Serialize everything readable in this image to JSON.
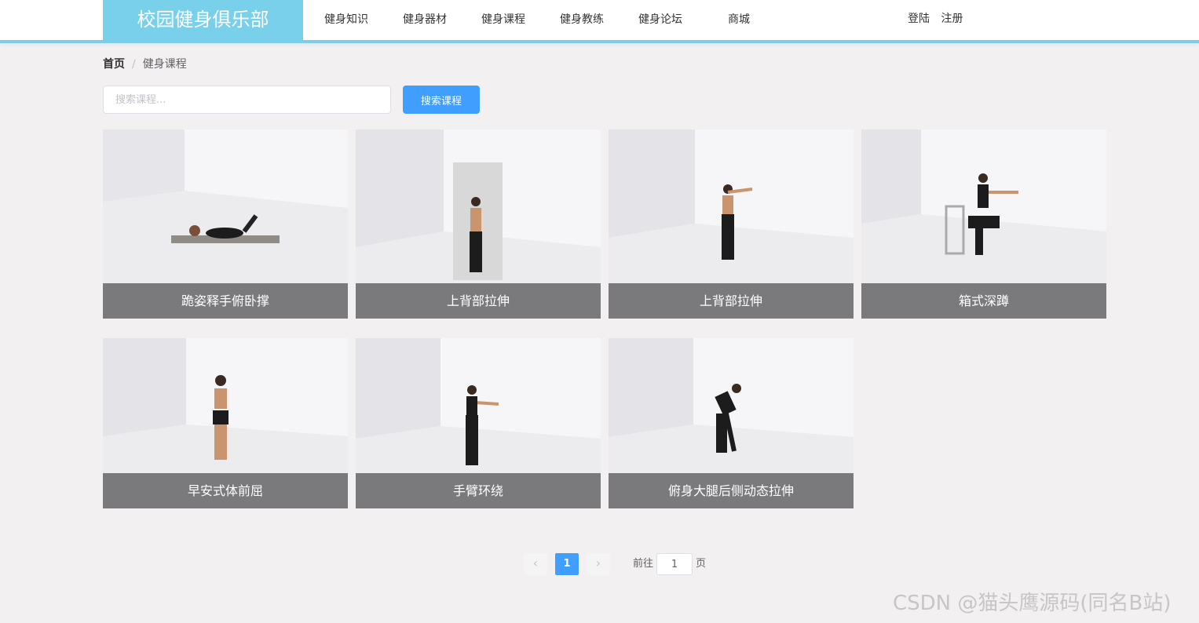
{
  "header": {
    "logo": "校园健身俱乐部",
    "nav": [
      "健身知识",
      "健身器材",
      "健身课程",
      "健身教练",
      "健身论坛",
      "商城"
    ],
    "login": "登陆",
    "register": "注册"
  },
  "breadcrumb": {
    "home": "首页",
    "separator": "/",
    "current": "健身课程"
  },
  "search": {
    "placeholder": "搜索课程...",
    "button": "搜索课程"
  },
  "courses": [
    {
      "title": "跪姿释手俯卧撑"
    },
    {
      "title": "上背部拉伸"
    },
    {
      "title": "上背部拉伸"
    },
    {
      "title": "箱式深蹲"
    },
    {
      "title": "早安式体前屈"
    },
    {
      "title": "手臂环绕"
    },
    {
      "title": "俯身大腿后侧动态拉伸"
    }
  ],
  "pagination": {
    "prev": "‹",
    "current": "1",
    "next": "›",
    "goto_label": "前往",
    "goto_value": "1",
    "goto_suffix": "页"
  },
  "watermark": "CSDN @猫头鹰源码(同名B站)",
  "colors": {
    "accent": "#79d0ea",
    "primary": "#409eff",
    "background": "#f2f0f1"
  }
}
